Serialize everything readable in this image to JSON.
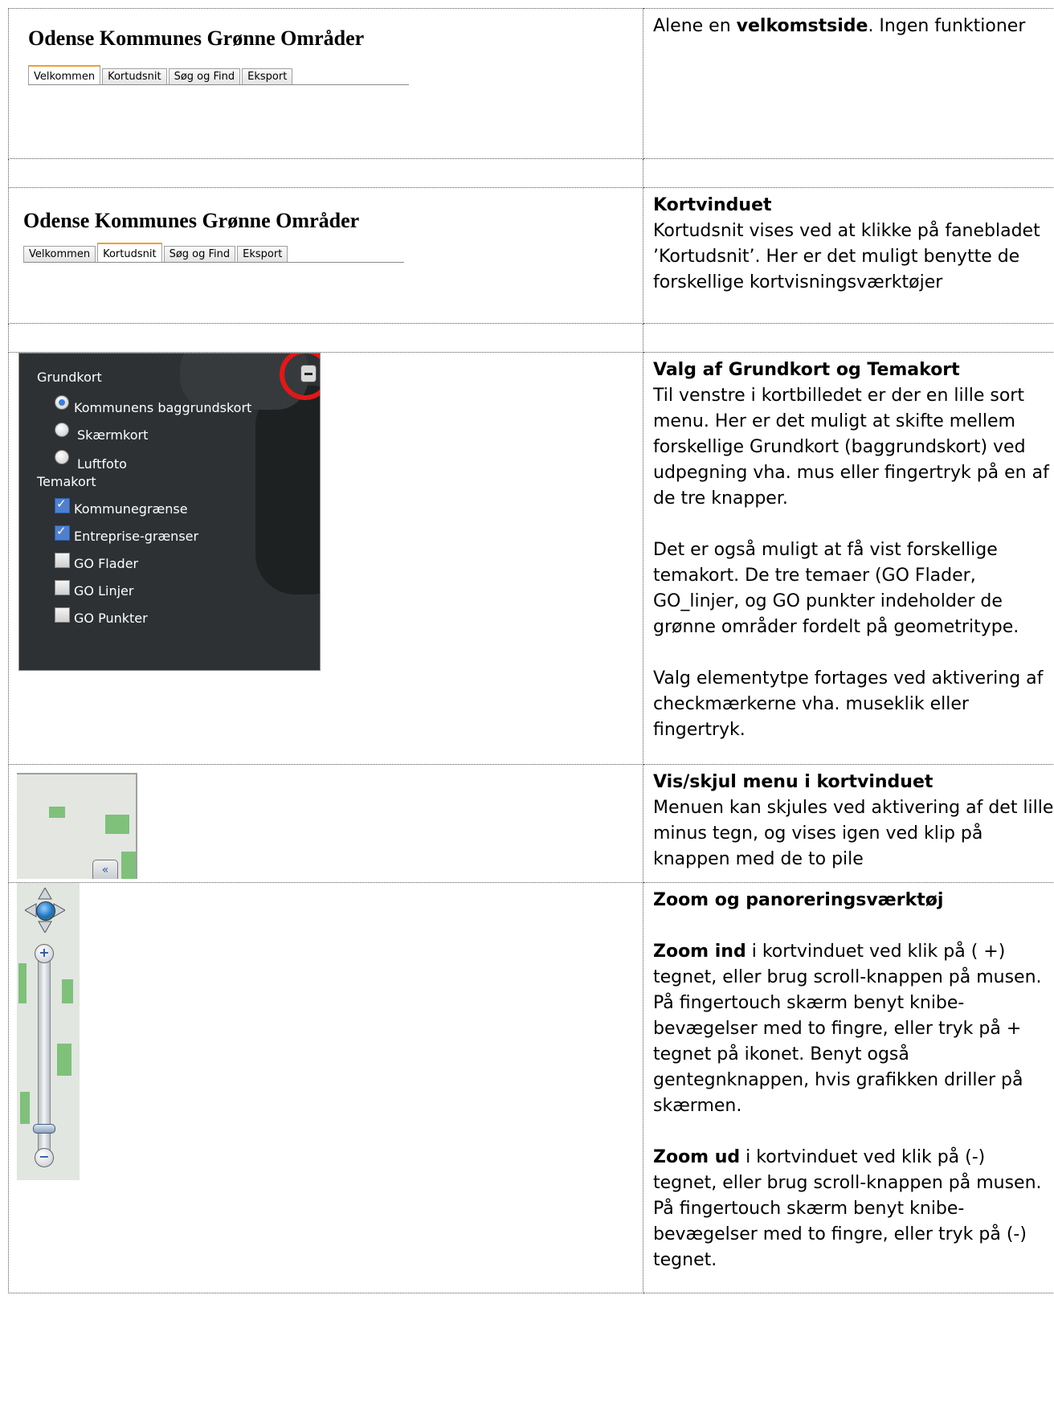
{
  "rows": [
    {
      "app_title": "Odense Kommunes Grønne Områder",
      "tabs": [
        "Velkommen",
        "Kortudsnit",
        "Søg og Find",
        "Eksport"
      ],
      "active_tab": "Velkommen",
      "text_pre": "Alene en ",
      "text_bold": "velkomstside",
      "text_post": ". Ingen funktioner"
    },
    {
      "app_title": "Odense Kommunes Grønne Områder",
      "tabs": [
        "Velkommen",
        "Kortudsnit",
        "Søg og Find",
        "Eksport"
      ],
      "active_tab": "Kortudsnit",
      "heading": "Kortvinduet",
      "body": "Kortudsnit vises  ved at klikke på fanebladet ’Kortudsnit’. Her er det muligt benytte de forskellige kortvisningsværktøjer"
    },
    {
      "menu": {
        "grundkort_label": "Grundkort",
        "grundkort": [
          {
            "label": "Kommunens baggrundskort",
            "selected": true
          },
          {
            "label": "Skærmkort",
            "selected": false
          },
          {
            "label": "Luftfoto",
            "selected": false
          }
        ],
        "temakort_label": "Temakort",
        "temakort": [
          {
            "label": "Kommunegrænse",
            "checked": true
          },
          {
            "label": "Entreprise-grænser",
            "checked": true
          },
          {
            "label": "GO Flader",
            "checked": false
          },
          {
            "label": "GO Linjer",
            "checked": false
          },
          {
            "label": "GO Punkter",
            "checked": false
          }
        ],
        "highlight_color": "#e01818"
      },
      "heading": "Valg af Grundkort og Temakort",
      "para1": "Til venstre i kortbilledet er der en lille sort menu. Her er det muligt at skifte mellem forskellige Grundkort (baggrundskort) ved udpegning vha. mus eller fingertryk på en af de tre knapper.",
      "para2": "Det er også muligt at få vist forskellige temakort.  De tre temaer (GO Flader, GO_linjer, og GO punkter indeholder de grønne områder fordelt på geometritype.",
      "para3": "Valg elementytpe fortages ved aktivering af checkmærkerne vha. museklik eller fingertryk."
    },
    {
      "icon": "double-arrow-left-icon",
      "heading": "Vis/skjul menu i kortvinduet",
      "body": "Menuen kan skjules ved aktivering af det lille minus tegn, og  vises igen ved klip på knappen med de to pile"
    },
    {
      "icons": [
        "pan-arrows-icon",
        "globe-icon",
        "zoom-in-icon",
        "zoom-out-icon"
      ],
      "heading": "Zoom og panoreringsværktøj",
      "zoom_in_bold": "Zoom ind",
      "zoom_in_text": " i kortvinduet ved klik på ( +) tegnet, eller brug scroll-knappen på musen. På fingertouch skærm benyt knibe-bevægelser med to fingre, eller tryk på + tegnet på ikonet. Benyt også gentegnknappen, hvis grafikken driller på skærmen.",
      "zoom_out_bold": "Zoom ud",
      "zoom_out_text": " i kortvinduet ved klik på   (-) tegnet, eller brug scroll-knappen på musen. På fingertouch skærm benyt knibe-bevægelser med to fingre, eller tryk på (-) tegnet."
    }
  ]
}
